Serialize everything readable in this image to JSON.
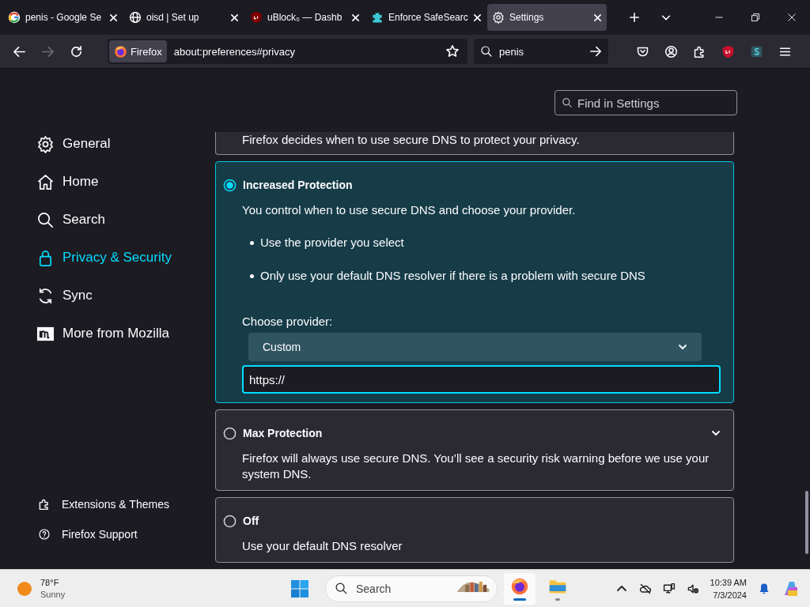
{
  "tabs": [
    {
      "title": "penis - Google Se",
      "selected": false
    },
    {
      "title": "oisd | Set up",
      "selected": false
    },
    {
      "title": "uBlock₀ — Dashb",
      "selected": false
    },
    {
      "title": "Enforce SafeSearc",
      "selected": false
    },
    {
      "title": "Settings",
      "selected": true
    }
  ],
  "nav_bar": {
    "identity": "Firefox",
    "url": "about:preferences#privacy",
    "search": "penis"
  },
  "settings": {
    "find": {
      "placeholder": "Find in Settings"
    },
    "sidebar": {
      "items": [
        {
          "label": "General",
          "selected": false
        },
        {
          "label": "Home",
          "selected": false
        },
        {
          "label": "Search",
          "selected": false
        },
        {
          "label": "Privacy & Security",
          "selected": true
        },
        {
          "label": "Sync",
          "selected": false
        },
        {
          "label": "More from Mozilla",
          "selected": false
        }
      ],
      "footer": [
        "Extensions & Themes",
        "Firefox Support"
      ]
    },
    "dns_options": [
      {
        "description": "Firefox decides when to use secure DNS to protect your privacy.",
        "selected": false
      },
      {
        "title": "Increased Protection",
        "description": "You control when to use secure DNS and choose your provider.",
        "selected": true,
        "bullets": [
          "Use the provider you select",
          "Only use your default DNS resolver if there is a problem with secure DNS"
        ],
        "provider_label": "Choose provider:",
        "provider": "Custom",
        "custom_url": "https://"
      },
      {
        "title": "Max Protection",
        "description": "Firefox will always use secure DNS. You’ll see a security risk warning before we use your system DNS.",
        "selected": false,
        "expanded": false
      },
      {
        "title": "Off",
        "description": "Use your default DNS resolver",
        "selected": false
      }
    ]
  },
  "taskbar": {
    "weather": {
      "temperature": "78°F",
      "condition": "Sunny"
    },
    "search": {
      "placeholder": "Search"
    },
    "apps": [
      {
        "selected": true
      },
      {
        "selected": false
      }
    ],
    "time": "10:39 AM",
    "date": "7/3/2024"
  }
}
